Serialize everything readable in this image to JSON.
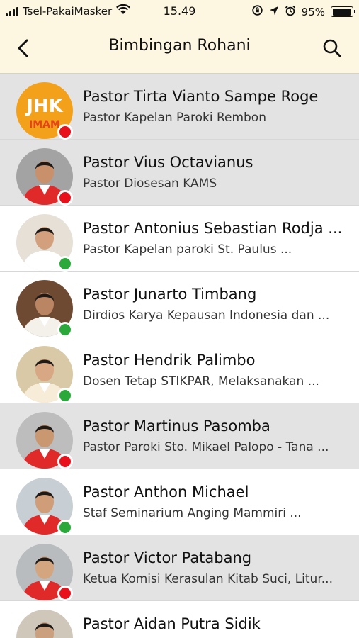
{
  "status_bar": {
    "carrier": "Tsel-PakaiMasker",
    "time": "15.49",
    "battery": "95%",
    "battery_level": 0.95
  },
  "header": {
    "title": "Bimbingan Rohani"
  },
  "colors": {
    "offline": "#e8101b",
    "online": "#2aa83a",
    "header_bg": "#fdf7e2",
    "row_gray": "#e3e3e3"
  },
  "contacts": [
    {
      "name": "Pastor Tirta Vianto Sampe Roge",
      "desc": "Pastor Kapelan Paroki Rembon",
      "status": "offline",
      "avatar": "jhk-logo"
    },
    {
      "name": "Pastor Vius Octavianus",
      "desc": "Pastor Diosesan KAMS",
      "status": "offline",
      "avatar": "person-photo"
    },
    {
      "name": "Pastor Antonius Sebastian Rodja ...",
      "desc": "Pastor Kapelan paroki St. Paulus ...",
      "status": "online",
      "avatar": "person-photo"
    },
    {
      "name": "Pastor Junarto Timbang",
      "desc": "Dirdios Karya Kepausan Indonesia dan ...",
      "status": "online",
      "avatar": "person-photo"
    },
    {
      "name": "Pastor Hendrik Palimbo",
      "desc": "Dosen Tetap STIKPAR, Melaksanakan ...",
      "status": "online",
      "avatar": "person-photo"
    },
    {
      "name": "Pastor Martinus Pasomba",
      "desc": "Pastor Paroki Sto. Mikael Palopo - Tana ...",
      "status": "offline",
      "avatar": "person-photo"
    },
    {
      "name": "Pastor Anthon Michael",
      "desc": "Staf Seminarium Anging Mammiri ...",
      "status": "online",
      "avatar": "person-photo"
    },
    {
      "name": "Pastor Victor Patabang",
      "desc": "Ketua Komisi Kerasulan Kitab Suci, Litur...",
      "status": "offline",
      "avatar": "person-photo"
    },
    {
      "name": "Pastor Aidan Putra Sidik",
      "desc": "",
      "status": "",
      "avatar": "person-photo"
    }
  ]
}
